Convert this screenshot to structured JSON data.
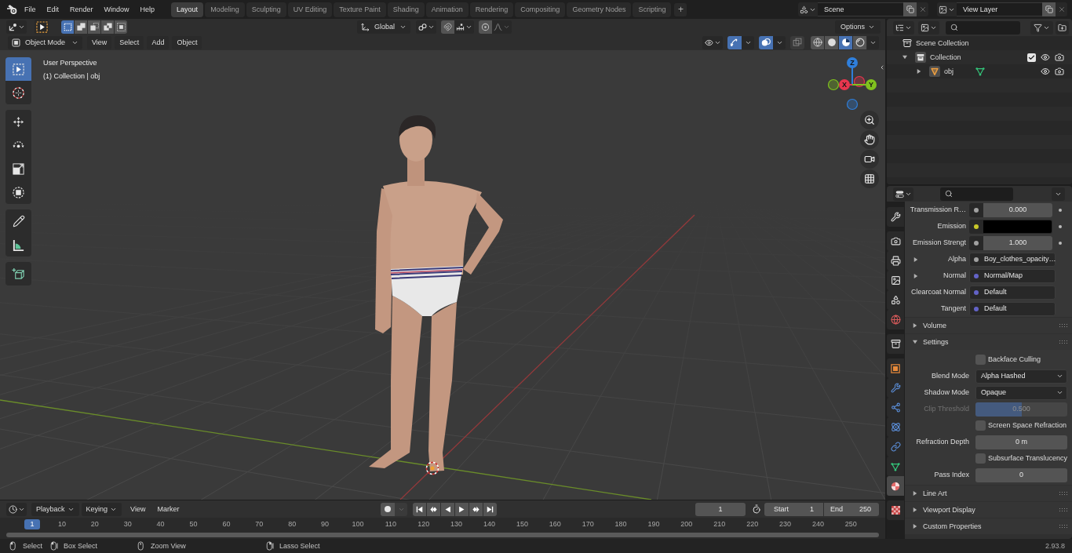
{
  "top_bar": {
    "menus": [
      "File",
      "Edit",
      "Render",
      "Window",
      "Help"
    ],
    "workspaces": [
      {
        "label": "Layout",
        "selected": true
      },
      {
        "label": "Modeling",
        "selected": false
      },
      {
        "label": "Sculpting",
        "selected": false
      },
      {
        "label": "UV Editing",
        "selected": false
      },
      {
        "label": "Texture Paint",
        "selected": false
      },
      {
        "label": "Shading",
        "selected": false
      },
      {
        "label": "Animation",
        "selected": false
      },
      {
        "label": "Rendering",
        "selected": false
      },
      {
        "label": "Compositing",
        "selected": false
      },
      {
        "label": "Geometry Nodes",
        "selected": false
      },
      {
        "label": "Scripting",
        "selected": false
      }
    ],
    "add_workspace": "+",
    "scene": "Scene",
    "view_layer": "View Layer"
  },
  "viewport_header": {
    "select_modes": [
      {
        "kind": "set",
        "selected": true
      },
      {
        "kind": "extend",
        "selected": false
      },
      {
        "kind": "subtract",
        "selected": false
      },
      {
        "kind": "difference",
        "selected": false
      },
      {
        "kind": "intersect",
        "selected": false
      }
    ],
    "orientation": "Global",
    "options": "Options",
    "mode": "Object Mode",
    "menus": [
      "View",
      "Select",
      "Add",
      "Object"
    ],
    "toggles": [
      {
        "kind": "gizmos",
        "on": true
      },
      {
        "kind": "overlays",
        "on": true
      },
      {
        "kind": "xray",
        "on": false
      }
    ],
    "shading": [
      {
        "kind": "wireframe",
        "selected": false
      },
      {
        "kind": "solid",
        "selected": false
      },
      {
        "kind": "material",
        "selected": true
      },
      {
        "kind": "rendered",
        "selected": false
      }
    ]
  },
  "viewport": {
    "tool_groups": [
      {
        "tools": [
          {
            "kind": "select_box",
            "selected": true
          },
          {
            "kind": "cursor",
            "selected": false
          }
        ]
      },
      {
        "tools": [
          {
            "kind": "move",
            "selected": false
          },
          {
            "kind": "rotate",
            "selected": false
          },
          {
            "kind": "scale",
            "selected": false
          },
          {
            "kind": "transform",
            "selected": false
          }
        ]
      },
      {
        "tools": [
          {
            "kind": "annotate",
            "selected": false
          },
          {
            "kind": "measure",
            "selected": false
          }
        ]
      },
      {
        "tools": [
          {
            "kind": "add_cube",
            "selected": false
          }
        ]
      }
    ],
    "view_name": "User Perspective",
    "collection_info": "(1) Collection | obj",
    "gizmo_axes": [
      {
        "label": "Z",
        "color": "#2f7fdb"
      },
      {
        "label": "X",
        "color": "#e8364e"
      },
      {
        "label": "Y",
        "color": "#80c21e"
      }
    ]
  },
  "outliner": {
    "tree": [
      {
        "label": "Scene Collection",
        "kind": "scene_collection",
        "children": [
          {
            "label": "Collection",
            "kind": "collection",
            "expanded": true,
            "checked": true,
            "children": [
              {
                "label": "obj",
                "kind": "mesh_object",
                "expanded": false
              }
            ]
          }
        ]
      }
    ]
  },
  "properties": {
    "tab_groups": [
      {
        "tabs": [
          {
            "kind": "tool",
            "selected": false
          }
        ]
      },
      {
        "tabs": [
          {
            "kind": "render",
            "selected": false
          },
          {
            "kind": "output",
            "selected": false
          },
          {
            "kind": "view_layer",
            "selected": false
          },
          {
            "kind": "scene",
            "selected": false
          },
          {
            "kind": "world",
            "selected": false
          }
        ]
      },
      {
        "tabs": [
          {
            "kind": "collection",
            "selected": false
          }
        ]
      },
      {
        "tabs": [
          {
            "kind": "object",
            "selected": false
          },
          {
            "kind": "modifiers",
            "selected": false
          },
          {
            "kind": "particles",
            "selected": false
          },
          {
            "kind": "physics",
            "selected": false
          },
          {
            "kind": "constraints",
            "selected": false
          },
          {
            "kind": "data",
            "selected": false
          },
          {
            "kind": "material",
            "selected": true
          }
        ]
      },
      {
        "tabs": [
          {
            "kind": "texture",
            "selected": false
          }
        ]
      }
    ],
    "inputs": [
      {
        "label": "Transmission R…",
        "socket": {
          "color": "#a1a1a1"
        },
        "kind": "number",
        "value": "0.000",
        "animatable": true
      },
      {
        "label": "Emission",
        "socket": {
          "color": "#c7c729"
        },
        "kind": "color",
        "color": "#000000",
        "animatable": true
      },
      {
        "label": "Emission Strengt",
        "socket": {
          "color": "#a1a1a1"
        },
        "kind": "number",
        "value": "1.000",
        "animatable": true
      },
      {
        "label": "Alpha",
        "socket": {
          "color": "#a1a1a1"
        },
        "kind": "link",
        "value": "Boy_clothes_opacity…",
        "expanded": false
      },
      {
        "label": "Normal",
        "socket": {
          "color": "#6363c7"
        },
        "kind": "link",
        "value": "Normal/Map",
        "expanded": false
      },
      {
        "label": "Clearcoat Normal",
        "socket": {
          "color": "#6363c7"
        },
        "kind": "link",
        "value": "Default"
      },
      {
        "label": "Tangent",
        "socket": {
          "color": "#6363c7"
        },
        "kind": "link",
        "value": "Default"
      }
    ],
    "panels": [
      {
        "label": "Volume",
        "expanded": false
      },
      {
        "label": "Settings",
        "expanded": true,
        "rows": [
          {
            "kind": "checkbox",
            "label": "Backface Culling",
            "checked": false
          },
          {
            "kind": "dropdown",
            "label": "Blend Mode",
            "value": "Alpha Hashed"
          },
          {
            "kind": "dropdown",
            "label": "Shadow Mode",
            "value": "Opaque"
          },
          {
            "kind": "slider",
            "label": "Clip Threshold",
            "value": "0.500",
            "level": 0.5,
            "disabled": true
          },
          {
            "kind": "checkbox",
            "label": "Screen Space Refraction",
            "checked": false
          },
          {
            "kind": "number",
            "label": "Refraction Depth",
            "value": "0 m"
          },
          {
            "kind": "checkbox",
            "label": "Subsurface Translucency",
            "checked": false
          },
          {
            "kind": "number",
            "label": "Pass Index",
            "value": "0"
          }
        ]
      },
      {
        "label": "Line Art",
        "expanded": false
      },
      {
        "label": "Viewport Display",
        "expanded": false
      },
      {
        "label": "Custom Properties",
        "expanded": false
      }
    ]
  },
  "timeline": {
    "menus": [
      {
        "label": "Playback",
        "kind": "dropdown"
      },
      {
        "label": "Keying",
        "kind": "dropdown"
      },
      {
        "label": "View",
        "kind": "menu"
      },
      {
        "label": "Marker",
        "kind": "menu"
      }
    ],
    "current_frame": "1",
    "start_label": "Start",
    "start": "1",
    "end_label": "End",
    "end": "250",
    "frames": [
      {
        "label": "1",
        "selected": true
      },
      {
        "label": "10",
        "selected": false
      },
      {
        "label": "20",
        "selected": false
      },
      {
        "label": "30",
        "selected": false
      },
      {
        "label": "40",
        "selected": false
      },
      {
        "label": "50",
        "selected": false
      },
      {
        "label": "60",
        "selected": false
      },
      {
        "label": "70",
        "selected": false
      },
      {
        "label": "80",
        "selected": false
      },
      {
        "label": "90",
        "selected": false
      },
      {
        "label": "100",
        "selected": false
      },
      {
        "label": "110",
        "selected": false
      },
      {
        "label": "120",
        "selected": false
      },
      {
        "label": "130",
        "selected": false
      },
      {
        "label": "140",
        "selected": false
      },
      {
        "label": "150",
        "selected": false
      },
      {
        "label": "160",
        "selected": false
      },
      {
        "label": "170",
        "selected": false
      },
      {
        "label": "180",
        "selected": false
      },
      {
        "label": "190",
        "selected": false
      },
      {
        "label": "200",
        "selected": false
      },
      {
        "label": "210",
        "selected": false
      },
      {
        "label": "220",
        "selected": false
      },
      {
        "label": "230",
        "selected": false
      },
      {
        "label": "240",
        "selected": false
      },
      {
        "label": "250",
        "selected": false
      }
    ]
  },
  "status_bar": {
    "hints": [
      {
        "kind": "left_click",
        "label": "Select"
      },
      {
        "kind": "left_drag",
        "label": "Box Select"
      },
      {
        "kind": "middle_click",
        "label": "Zoom View"
      },
      {
        "kind": "right_drag",
        "label": "Lasso Select"
      }
    ],
    "version": "2.93.8"
  }
}
